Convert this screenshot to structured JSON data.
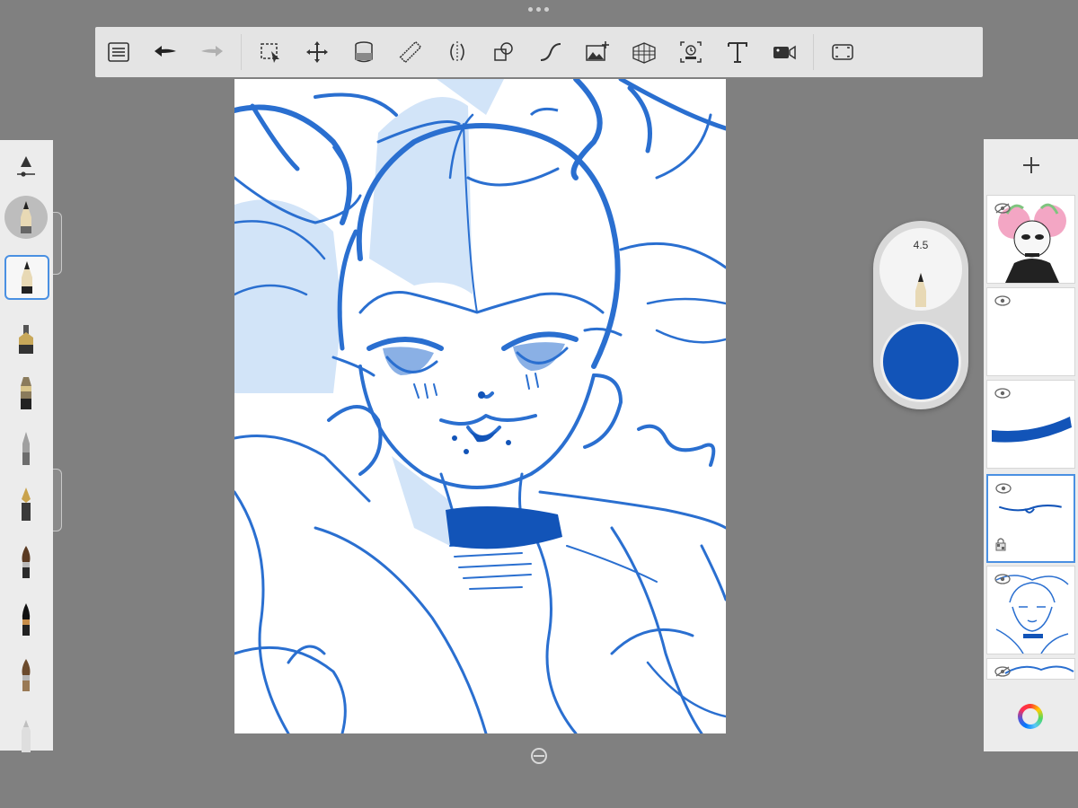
{
  "app": {
    "top_toolbar": {
      "buttons": [
        {
          "name": "layers-menu-button",
          "icon": "list-icon"
        },
        {
          "name": "undo-button",
          "icon": "undo-arrow-icon"
        },
        {
          "name": "redo-button",
          "icon": "redo-arrow-icon"
        },
        {
          "name": "selection-button",
          "icon": "marquee-select-icon"
        },
        {
          "name": "transform-button",
          "icon": "move-arrows-icon"
        },
        {
          "name": "fill-button",
          "icon": "paint-bucket-icon"
        },
        {
          "name": "ruler-button",
          "icon": "ruler-icon"
        },
        {
          "name": "symmetry-button",
          "icon": "symmetry-icon"
        },
        {
          "name": "shape-button",
          "icon": "shapes-icon"
        },
        {
          "name": "curve-button",
          "icon": "curve-icon"
        },
        {
          "name": "image-button",
          "icon": "add-image-icon"
        },
        {
          "name": "perspective-button",
          "icon": "perspective-grid-icon"
        },
        {
          "name": "time-lapse-button",
          "icon": "timelapse-icon"
        },
        {
          "name": "text-button",
          "icon": "text-icon"
        },
        {
          "name": "record-button",
          "icon": "video-camera-icon"
        },
        {
          "name": "fullscreen-button",
          "icon": "fullscreen-icon"
        }
      ]
    },
    "brush_puck": {
      "size_value": "4.5",
      "color": "#1254b8"
    },
    "brushes": [
      {
        "name": "pencil",
        "selected": false
      },
      {
        "name": "pencil",
        "selected": true
      },
      {
        "name": "marker",
        "selected": false
      },
      {
        "name": "airbrush",
        "selected": false
      },
      {
        "name": "ballpoint",
        "selected": false
      },
      {
        "name": "fountain-pen",
        "selected": false
      },
      {
        "name": "paint-brush",
        "selected": false
      },
      {
        "name": "ink-brush",
        "selected": false
      },
      {
        "name": "watercolor-brush",
        "selected": false
      },
      {
        "name": "eraser",
        "selected": false
      }
    ],
    "layers": {
      "count": 6,
      "active_index": 3
    },
    "colors": {
      "sketch_blue": "#2a6fd0",
      "fill_light_blue": "#d2e4f8",
      "background": "#808080"
    }
  }
}
